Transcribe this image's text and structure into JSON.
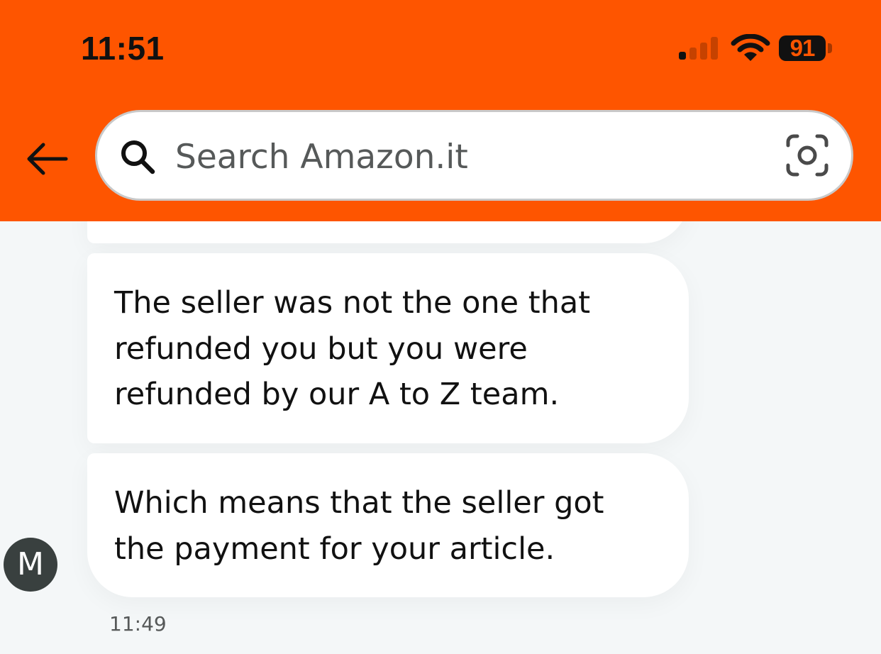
{
  "status_bar": {
    "time": "11:51",
    "battery_level": "91",
    "signal_bars_active": 1,
    "signal_bars_total": 4
  },
  "header": {
    "background_color": "#fe5500",
    "back_icon": "arrow-left-icon",
    "search": {
      "placeholder": "Search Amazon.it",
      "value": "",
      "icon": "search-icon",
      "camera_icon": "camera-lens-icon"
    }
  },
  "chat": {
    "messages": [
      {
        "text": "The seller was not the one that refunded you but you were refunded by our A to Z team."
      },
      {
        "text": "Which means that the seller got the payment for your article."
      }
    ],
    "agent_avatar_initial": "M",
    "timestamp": "11:49"
  }
}
